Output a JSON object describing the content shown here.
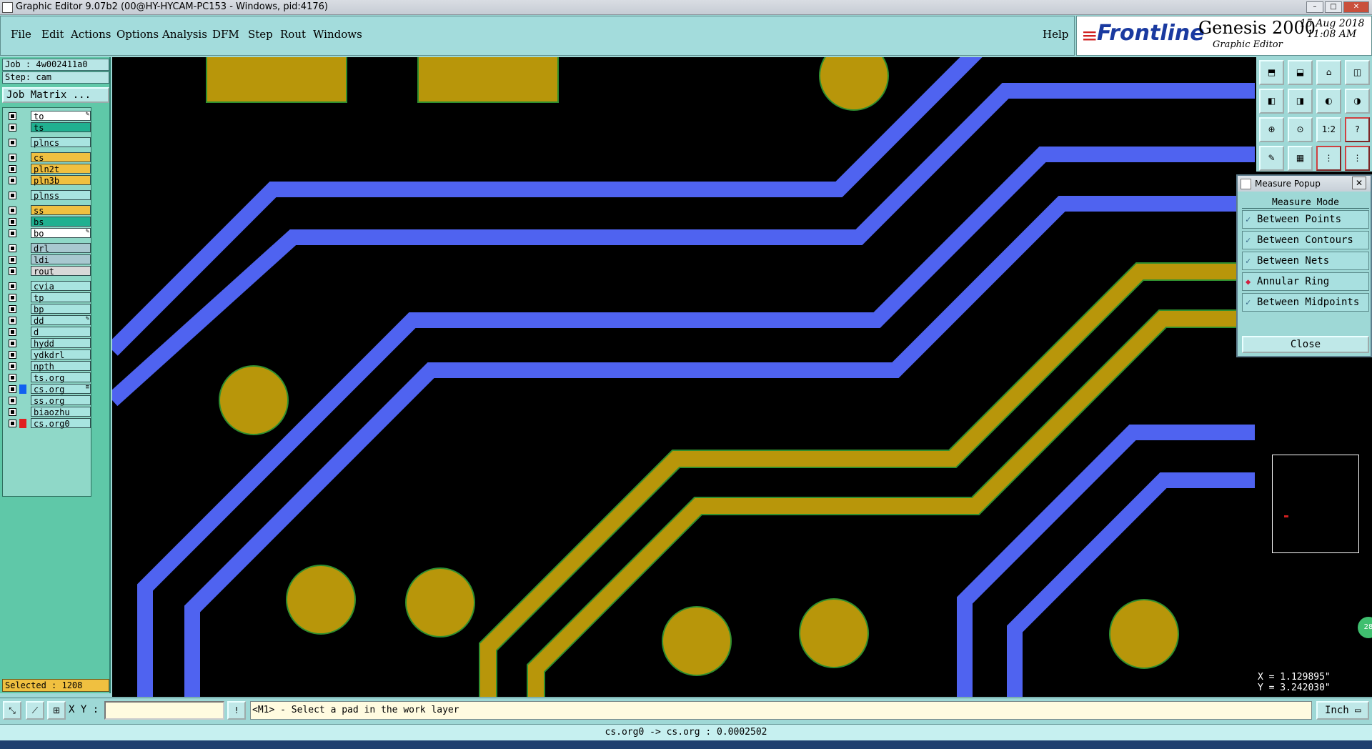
{
  "window": {
    "title": "Graphic Editor 9.07b2 (00@HY-HYCAM-PC153 - Windows, pid:4176)"
  },
  "menu": [
    "File",
    "Edit",
    "Actions",
    "Options",
    "Analysis",
    "DFM",
    "Step",
    "Rout",
    "Windows"
  ],
  "help_label": "Help",
  "brand": {
    "logo": "Frontline",
    "product": "Genesis 2000",
    "subtitle": "Graphic Editor",
    "date": "15 Aug 2018",
    "time": "11:08 AM"
  },
  "job": {
    "job_line": "Job : 4w002411a0",
    "step_line": "Step: cam",
    "matrix_button": "Job Matrix ..."
  },
  "layers": [
    {
      "name": "to",
      "color": "#ffffff",
      "mark": "✎"
    },
    {
      "name": "ts",
      "color": "#20b090",
      "mark": ""
    },
    {
      "name": "plncs",
      "color": "#a8e4e0",
      "mark": ""
    },
    {
      "name": "cs",
      "color": "#f0c040",
      "mark": ""
    },
    {
      "name": "pln2t",
      "color": "#f0c040",
      "mark": ""
    },
    {
      "name": "pln3b",
      "color": "#f0c040",
      "mark": ""
    },
    {
      "name": "plnss",
      "color": "#a8e4e0",
      "mark": ""
    },
    {
      "name": "ss",
      "color": "#f0c040",
      "mark": ""
    },
    {
      "name": "bs",
      "color": "#20b090",
      "mark": ""
    },
    {
      "name": "bo",
      "color": "#ffffff",
      "mark": "✎"
    },
    {
      "name": "drl",
      "color": "#a8c8d0",
      "mark": ""
    },
    {
      "name": "ldi",
      "color": "#a8c8d0",
      "mark": ""
    },
    {
      "name": "rout",
      "color": "#d8d8d8",
      "mark": ""
    },
    {
      "name": "cvia",
      "color": "#a8e4e0",
      "mark": ""
    },
    {
      "name": "tp",
      "color": "#a8e4e0",
      "mark": ""
    },
    {
      "name": "bp",
      "color": "#a8e4e0",
      "mark": ""
    },
    {
      "name": "dd",
      "color": "#a8e4e0",
      "mark": "✎"
    },
    {
      "name": "d",
      "color": "#a8e4e0",
      "mark": ""
    },
    {
      "name": "hydd",
      "color": "#a8e4e0",
      "mark": ""
    },
    {
      "name": "ydkdrl",
      "color": "#a8e4e0",
      "mark": ""
    },
    {
      "name": "npth",
      "color": "#a8e4e0",
      "mark": ""
    },
    {
      "name": "ts.org",
      "color": "#a8e4e0",
      "mark": ""
    },
    {
      "name": "cs.org",
      "color": "#a8e4e0",
      "mark": "≡"
    },
    {
      "name": "ss.org",
      "color": "#a8e4e0",
      "mark": ""
    },
    {
      "name": "biaozhu",
      "color": "#a8e4e0",
      "mark": ""
    },
    {
      "name": "cs.org0",
      "color": "#a8e4e0",
      "mark": ""
    }
  ],
  "selected_text": "Selected : 1208",
  "measure": {
    "title": "Measure Popup",
    "mode_label": "Measure Mode",
    "options": [
      "Between Points",
      "Between Contours",
      "Between Nets",
      "Annular Ring",
      "Between Midpoints"
    ],
    "selected": "Annular Ring",
    "close_label": "Close"
  },
  "tools": [
    "ul",
    "dl",
    "home",
    "ur",
    "l",
    "r",
    "lr",
    "ud",
    "zoom",
    "fit",
    "1:2",
    "?",
    "feat",
    "grid",
    "snap",
    "align"
  ],
  "coords": {
    "x": "X = 1.129895\"",
    "y": "Y = 3.242030\""
  },
  "xy_label": "X Y :",
  "prompt": "<M1> - Select a pad in the work layer",
  "unit": "Inch",
  "status": "cs.org0 -> cs.org : 0.0002502",
  "colors": {
    "trace_blue": "#4f63f0",
    "trace_gold": "#b8960a",
    "canvas": "#000000"
  }
}
